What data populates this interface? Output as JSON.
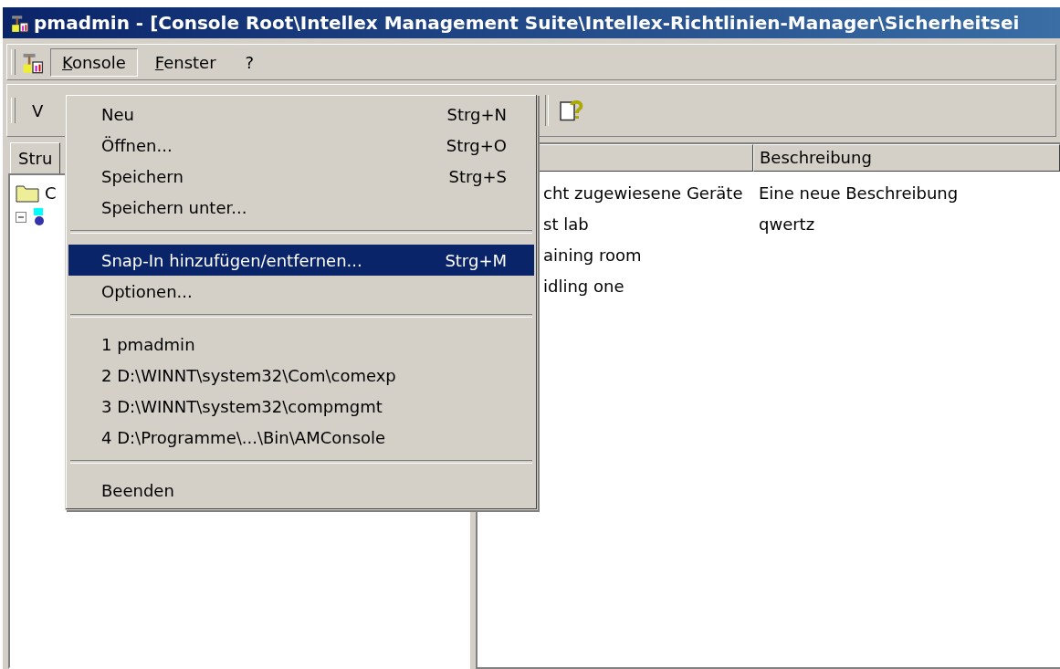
{
  "window": {
    "title": "pmadmin - [Console Root\\Intellex Management Suite\\Intellex-Richtlinien-Manager\\Sicherheitsei"
  },
  "menubar": [
    {
      "label": "Konsole",
      "selected": true
    },
    {
      "label": "Fenster",
      "selected": false
    },
    {
      "label": "?",
      "selected": false
    }
  ],
  "toolbar": {
    "action_label": "V"
  },
  "tree_tab": {
    "label": "Stru"
  },
  "tree": [
    {
      "label": "C",
      "expanded": false
    },
    {
      "expanded": true
    }
  ],
  "list": {
    "columns": [
      "",
      "Beschreibung"
    ],
    "rows": [
      [
        "cht zugewiesene Geräte",
        "Eine neue Beschreibung"
      ],
      [
        "st lab",
        "qwertz"
      ],
      [
        "aining room",
        ""
      ],
      [
        "idling one",
        ""
      ]
    ]
  },
  "menu": [
    {
      "kind": "item",
      "label": "Neu",
      "shortcut": "Strg+N",
      "selected": false
    },
    {
      "kind": "item",
      "label": "Öffnen...",
      "shortcut": "Strg+O",
      "selected": false
    },
    {
      "kind": "item",
      "label": "Speichern",
      "shortcut": "Strg+S",
      "selected": false
    },
    {
      "kind": "item",
      "label": "Speichern unter...",
      "selected": false
    },
    {
      "kind": "separator"
    },
    {
      "kind": "item",
      "label": "Snap-In hinzufügen/entfernen...",
      "shortcut": "Strg+M",
      "selected": true
    },
    {
      "kind": "item",
      "label": "Optionen...",
      "selected": false
    },
    {
      "kind": "separator"
    },
    {
      "kind": "item",
      "label": "1 pmadmin",
      "selected": false
    },
    {
      "kind": "item",
      "label": "2 D:\\WINNT\\system32\\Com\\comexp",
      "selected": false
    },
    {
      "kind": "item",
      "label": "3 D:\\WINNT\\system32\\compmgmt",
      "selected": false
    },
    {
      "kind": "item",
      "label": "4 D:\\Programme\\...\\Bin\\AMConsole",
      "selected": false
    },
    {
      "kind": "separator"
    },
    {
      "kind": "item",
      "label": "Beenden",
      "selected": false
    }
  ]
}
